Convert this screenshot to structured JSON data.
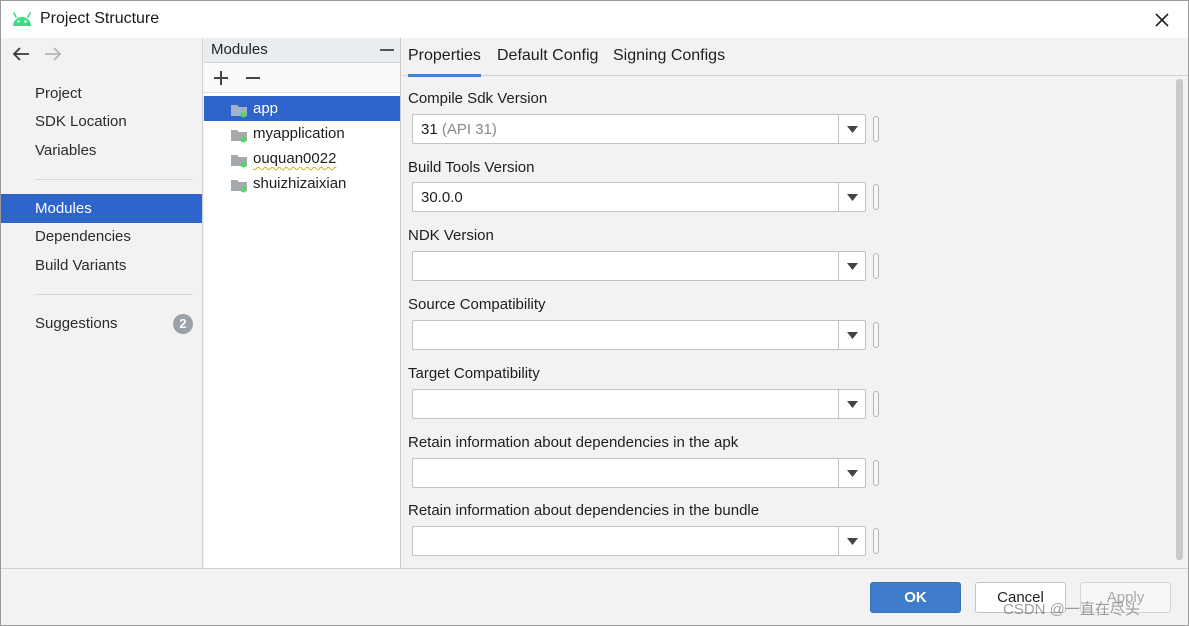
{
  "window": {
    "title": "Project Structure",
    "app_icon": "android-icon"
  },
  "nav": {
    "back_icon": "arrow-left-icon",
    "forward_icon": "arrow-right-icon",
    "items": [
      {
        "label": "Project"
      },
      {
        "label": "SDK Location"
      },
      {
        "label": "Variables"
      },
      {
        "label": "Modules",
        "selected": true
      },
      {
        "label": "Dependencies"
      },
      {
        "label": "Build Variants"
      },
      {
        "label": "Suggestions",
        "badge": "2"
      }
    ]
  },
  "modules": {
    "header": "Modules",
    "add_icon": "plus-icon",
    "remove_icon": "minus-icon",
    "items": [
      {
        "label": "app",
        "selected": true
      },
      {
        "label": "myapplication"
      },
      {
        "label": "ouquan0022"
      },
      {
        "label": "shuizhizaixian"
      }
    ]
  },
  "tabs": [
    {
      "label": "Properties",
      "active": true
    },
    {
      "label": "Default Config"
    },
    {
      "label": "Signing Configs"
    }
  ],
  "fields": [
    {
      "label": "Compile Sdk Version",
      "value": "31",
      "hint": "(API 31)"
    },
    {
      "label": "Build Tools Version",
      "value": "30.0.0",
      "hint": ""
    },
    {
      "label": "NDK Version",
      "value": "",
      "hint": ""
    },
    {
      "label": "Source Compatibility",
      "value": "",
      "hint": ""
    },
    {
      "label": "Target Compatibility",
      "value": "",
      "hint": ""
    },
    {
      "label": "Retain information about dependencies in the apk",
      "value": "",
      "hint": ""
    },
    {
      "label": "Retain information about dependencies in the bundle",
      "value": "",
      "hint": ""
    }
  ],
  "buttons": {
    "ok": "OK",
    "cancel": "Cancel",
    "apply": "Apply"
  },
  "watermark": "CSDN @一直在尽头",
  "colors": {
    "selection": "#2f65ca",
    "accent": "#4083c9",
    "ok_button": "#3f7ccb"
  }
}
